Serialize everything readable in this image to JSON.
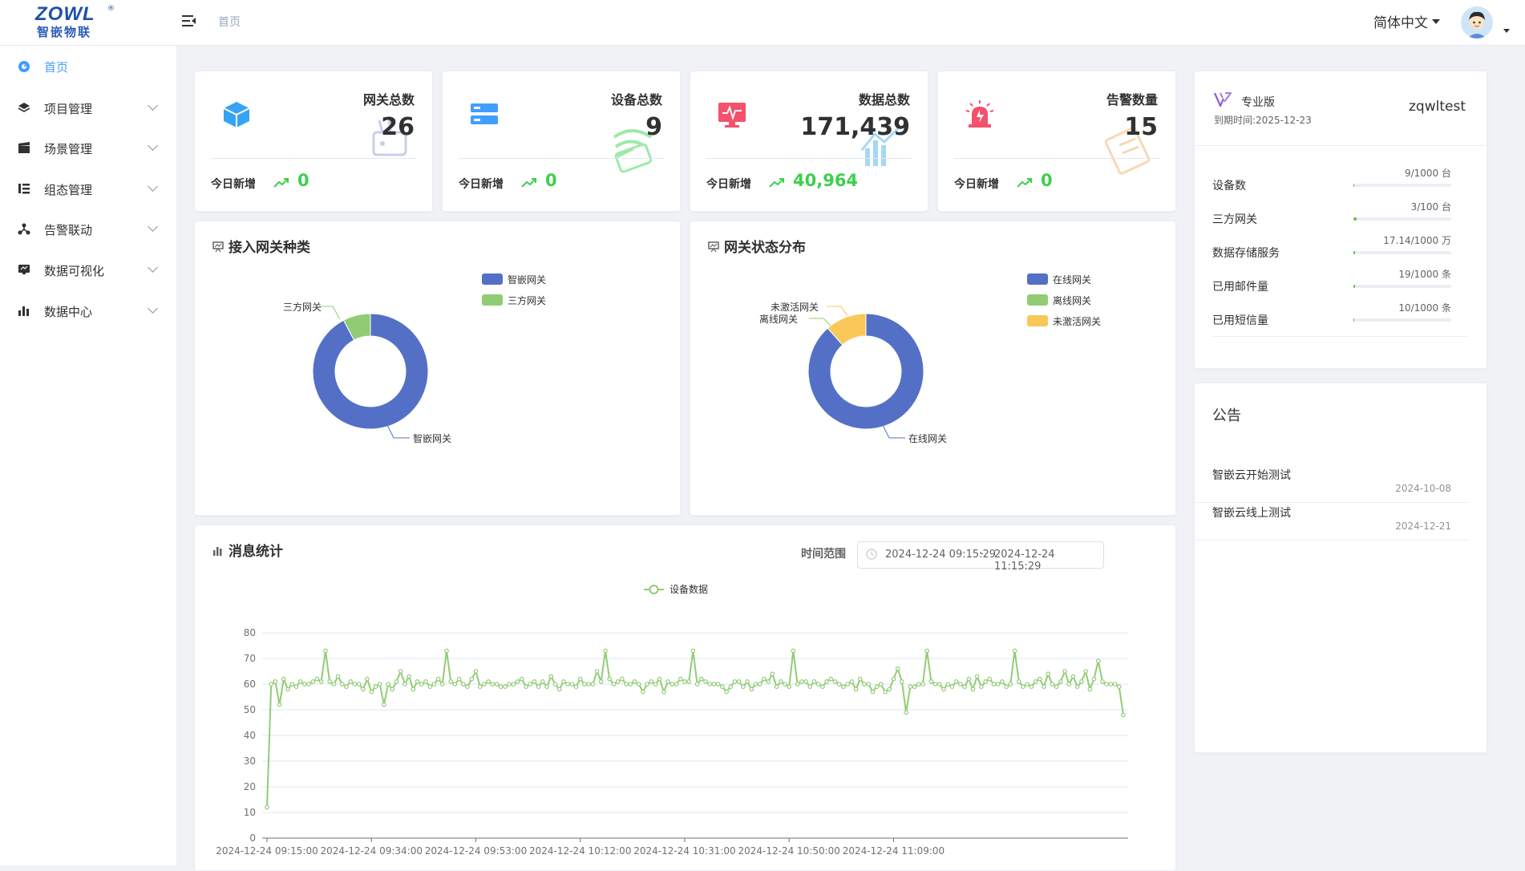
{
  "header": {
    "logo_text": "ZOWL",
    "logo_reg": "®",
    "logo_subtitle": "智嵌物联",
    "breadcrumb": "首页",
    "language": "简体中文"
  },
  "sidebar": {
    "items": [
      {
        "label": "首页",
        "icon": "dashboard-icon",
        "active": true,
        "expandable": false
      },
      {
        "label": "项目管理",
        "icon": "layers-icon",
        "active": false,
        "expandable": true
      },
      {
        "label": "场景管理",
        "icon": "clapperboard-icon",
        "active": false,
        "expandable": true
      },
      {
        "label": "组态管理",
        "icon": "list-icon",
        "active": false,
        "expandable": true
      },
      {
        "label": "告警联动",
        "icon": "network-icon",
        "active": false,
        "expandable": true
      },
      {
        "label": "数据可视化",
        "icon": "monitor-icon",
        "active": false,
        "expandable": true
      },
      {
        "label": "数据中心",
        "icon": "bar-chart-icon",
        "active": false,
        "expandable": true
      }
    ]
  },
  "stats": [
    {
      "title": "网关总数",
      "value": "26",
      "today_label": "今日新增",
      "today_value": "0",
      "icon": "cube-icon",
      "color": "#36a3f7"
    },
    {
      "title": "设备总数",
      "value": "9",
      "today_label": "今日新增",
      "today_value": "0",
      "icon": "server-icon",
      "color": "#409eff"
    },
    {
      "title": "数据总数",
      "value": "171,439",
      "today_label": "今日新增",
      "today_value": "40,964",
      "icon": "pulse-monitor-icon",
      "color": "#f4516c"
    },
    {
      "title": "告警数量",
      "value": "15",
      "today_label": "今日新增",
      "today_value": "0",
      "icon": "alarm-icon",
      "color": "#f4516c"
    }
  ],
  "gateway_types": {
    "title": "接入网关种类",
    "legend": [
      {
        "name": "智嵌网关",
        "color": "#5470c6"
      },
      {
        "name": "三方网关",
        "color": "#91cc75"
      }
    ],
    "slices": [
      {
        "name": "智嵌网关",
        "value": 24,
        "color": "#5470c6"
      },
      {
        "name": "三方网关",
        "value": 2,
        "color": "#91cc75"
      }
    ]
  },
  "gateway_status": {
    "title": "网关状态分布",
    "legend": [
      {
        "name": "在线网关",
        "color": "#5470c6"
      },
      {
        "name": "离线网关",
        "color": "#91cc75"
      },
      {
        "name": "未激活网关",
        "color": "#fac858"
      }
    ],
    "slices": [
      {
        "name": "在线网关",
        "value": 23,
        "color": "#5470c6"
      },
      {
        "name": "离线网关",
        "value": 0,
        "color": "#91cc75"
      },
      {
        "name": "未激活网关",
        "value": 3,
        "color": "#fac858"
      }
    ]
  },
  "account": {
    "edition": "专业版",
    "expiry": "到期时间:2025-12-23",
    "username": "zqwltest",
    "usage": [
      {
        "label": "设备数",
        "value": "9/1000 台",
        "fraction": 0.009
      },
      {
        "label": "三方网关",
        "value": "3/100 台",
        "fraction": 0.03
      },
      {
        "label": "数据存储服务",
        "value": "17.14/1000 万",
        "fraction": 0.017
      },
      {
        "label": "已用邮件量",
        "value": "19/1000 条",
        "fraction": 0.019
      },
      {
        "label": "已用短信量",
        "value": "10/1000 条",
        "fraction": 0.01
      }
    ]
  },
  "notices": {
    "title": "公告",
    "items": [
      {
        "text": "智嵌云开始测试",
        "date": "2024-10-08"
      },
      {
        "text": "智嵌云线上测试",
        "date": "2024-12-21"
      }
    ]
  },
  "message_stats": {
    "title": "消息统计",
    "range_label": "时间范围",
    "range_start": "2024-12-24 09:15:29",
    "range_sep": "-",
    "range_end": "2024-12-24 11:15:29"
  },
  "chart_data": {
    "type": "line",
    "title": "消息统计",
    "series": [
      {
        "name": "设备数据",
        "color": "#91cc75",
        "values": [
          12,
          60,
          61,
          52,
          62,
          58,
          60,
          59,
          61,
          60,
          60,
          61,
          62,
          61,
          73,
          61,
          60,
          63,
          60,
          59,
          61,
          60,
          60,
          58,
          62,
          57,
          59,
          60,
          52,
          60,
          58,
          61,
          65,
          60,
          63,
          58,
          61,
          60,
          61,
          59,
          60,
          62,
          60,
          73,
          61,
          60,
          62,
          60,
          59,
          62,
          65,
          59,
          60,
          61,
          60,
          60,
          59,
          59,
          60,
          60,
          61,
          62,
          59,
          60,
          61,
          59,
          61,
          59,
          63,
          60,
          58,
          61,
          60,
          60,
          59,
          62,
          60,
          60,
          60,
          65,
          61,
          73,
          62,
          60,
          61,
          62,
          60,
          60,
          61,
          60,
          57,
          60,
          61,
          60,
          62,
          57,
          61,
          60,
          60,
          62,
          61,
          61,
          73,
          60,
          62,
          61,
          60,
          60,
          60,
          59,
          57,
          59,
          61,
          61,
          59,
          61,
          58,
          60,
          60,
          62,
          61,
          64,
          59,
          61,
          60,
          59,
          73,
          60,
          61,
          61,
          59,
          61,
          60,
          59,
          61,
          62,
          61,
          60,
          59,
          60,
          61,
          58,
          62,
          60,
          60,
          57,
          59,
          60,
          57,
          58,
          62,
          66,
          61,
          49,
          59,
          59,
          60,
          60,
          73,
          61,
          60,
          60,
          58,
          60,
          59,
          61,
          60,
          59,
          62,
          58,
          63,
          59,
          61,
          62,
          60,
          60,
          61,
          59,
          60,
          73,
          61,
          59,
          60,
          59,
          61,
          62,
          59,
          64,
          60,
          59,
          61,
          65,
          60,
          63,
          59,
          61,
          65,
          58,
          62,
          69,
          61,
          60,
          60,
          60,
          59,
          48
        ]
      }
    ],
    "x_ticks": [
      "2024-12-24 09:15:00",
      "2024-12-24 09:34:00",
      "2024-12-24 09:53:00",
      "2024-12-24 10:12:00",
      "2024-12-24 10:31:00",
      "2024-12-24 10:50:00",
      "2024-12-24 11:09:00"
    ],
    "y_ticks": [
      0,
      10,
      20,
      30,
      40,
      50,
      60,
      70,
      80
    ],
    "ylim": [
      0,
      80
    ],
    "legend_position": "top-center",
    "grid": true
  }
}
